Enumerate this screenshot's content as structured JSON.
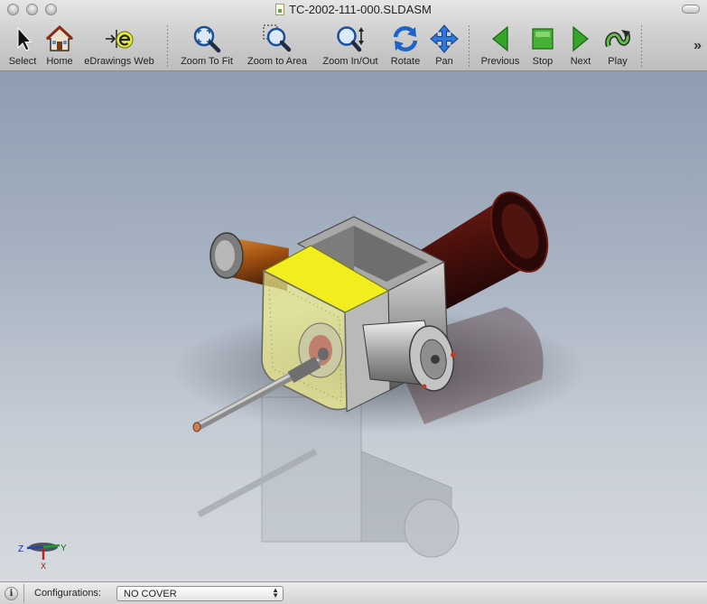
{
  "window": {
    "title": "TC-2002-111-000.SLDASM"
  },
  "toolbar": {
    "tools": [
      {
        "id": "select",
        "label": "Select",
        "icon": "arrow-cursor-icon"
      },
      {
        "id": "home",
        "label": "Home",
        "icon": "house-icon"
      },
      {
        "id": "edrawings-web",
        "label": "eDrawings Web",
        "icon": "edrawings-e-icon"
      },
      {
        "id": "zoom-to-fit",
        "label": "Zoom To Fit",
        "icon": "magnifier-fit-icon"
      },
      {
        "id": "zoom-to-area",
        "label": "Zoom to Area",
        "icon": "magnifier-area-icon"
      },
      {
        "id": "zoom-in-out",
        "label": "Zoom In/Out",
        "icon": "magnifier-updown-icon"
      },
      {
        "id": "rotate",
        "label": "Rotate",
        "icon": "rotate-arrows-icon"
      },
      {
        "id": "pan",
        "label": "Pan",
        "icon": "four-way-arrow-icon"
      },
      {
        "id": "previous",
        "label": "Previous",
        "icon": "triangle-left-icon"
      },
      {
        "id": "stop",
        "label": "Stop",
        "icon": "square-stop-icon"
      },
      {
        "id": "next",
        "label": "Next",
        "icon": "triangle-right-icon"
      },
      {
        "id": "play",
        "label": "Play",
        "icon": "play-loop-icon"
      }
    ],
    "overflow": "»"
  },
  "axis_triad": {
    "z": "Z",
    "y": "Y",
    "x": "X"
  },
  "statusbar": {
    "info": "i",
    "configurations_label": "Configurations:",
    "configurations_value": "NO COVER"
  },
  "colors": {
    "accent_green": "#3fa32a",
    "accent_blue": "#2f6fd0",
    "cover_yellow": "#f2ee1e",
    "motor_dark_red": "#5a1410",
    "motor_orange": "#b05a16"
  }
}
